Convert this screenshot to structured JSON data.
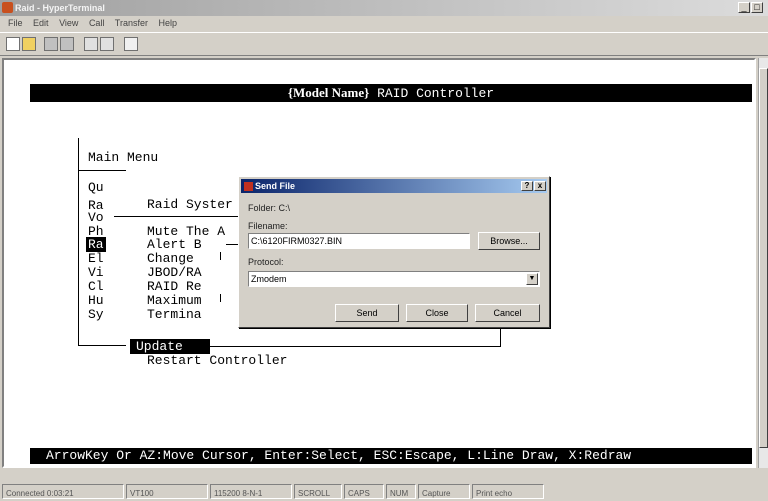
{
  "window": {
    "title": "Raid - HyperTerminal",
    "min_symbol": "_",
    "max_symbol": "□",
    "close_symbol": "x"
  },
  "menubar": [
    "File",
    "Edit",
    "View",
    "Call",
    "Transfer",
    "Help"
  ],
  "toolbar_icons": [
    "new-icon",
    "open-icon",
    "connect-icon",
    "disconnect-icon",
    "send-icon",
    "receive-icon",
    "properties-icon"
  ],
  "terminal": {
    "header_model": "{Model Name}",
    "header_rest": " RAID Controller",
    "main_menu_title": "Main Menu",
    "main_menu_items": [
      "Qu",
      "Ra",
      "Vo",
      "Ph",
      "Ra",
      "El",
      "Vi",
      "Cl",
      "Hu",
      "Sy"
    ],
    "submenu_title": "Raid Syster",
    "submenu_items": [
      "Mute The A",
      "Alert B",
      "Change",
      "JBOD/RA",
      "RAID Re",
      "Maximum",
      "Termina",
      "Update",
      "Restart Controller"
    ],
    "submenu_mid_marks": [
      "",
      "",
      "",
      "",
      "",
      ""
    ],
    "help_line": "ArrowKey Or AZ:Move Cursor, Enter:Select, ESC:Escape, L:Line Draw, X:Redraw"
  },
  "dialog": {
    "title": "Send File",
    "help_symbol": "?",
    "close_symbol": "x",
    "folder_label": "Folder: C:\\",
    "filename_label": "Filename:",
    "filename_value": "C:\\6120FIRM0327.BIN",
    "browse_label": "Browse...",
    "protocol_label": "Protocol:",
    "protocol_value": "Zmodem",
    "send_label": "Send",
    "close_label": "Close",
    "cancel_label": "Cancel"
  },
  "statusbar": {
    "connected": "Connected 0:03:21",
    "terminal": "VT100",
    "settings": "115200 8-N-1",
    "scroll": "SCROLL",
    "caps": "CAPS",
    "num": "NUM",
    "capture": "Capture",
    "printecho": "Print echo"
  }
}
